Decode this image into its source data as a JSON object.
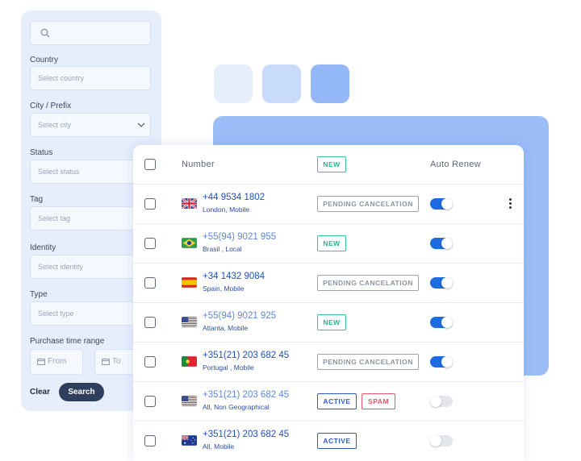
{
  "filters": {
    "search": {
      "placeholder": ""
    },
    "country": {
      "label": "Country",
      "placeholder": "Select country"
    },
    "city": {
      "label": "City / Prefix",
      "placeholder": "Select city"
    },
    "status": {
      "label": "Status",
      "placeholder": "Select status"
    },
    "tag": {
      "label": "Tag",
      "placeholder": "Select tag"
    },
    "identity": {
      "label": "Identity",
      "placeholder": "Select identity"
    },
    "type": {
      "label": "Type",
      "placeholder": "Select type"
    },
    "purchase": {
      "label": "Purchase time range",
      "from": "From",
      "to": "To"
    },
    "clear_label": "Clear",
    "search_label": "Search"
  },
  "table": {
    "headers": {
      "number": "Number",
      "status": "NEW",
      "auto_renew": "Auto Renew"
    },
    "rows": [
      {
        "flag": "uk",
        "number": "+44 9534 1802",
        "location": "London, Mobile",
        "badges": [
          "PENDING CANCELATION"
        ],
        "auto_renew": true,
        "muted": false
      },
      {
        "flag": "br",
        "number": "+55(94) 9021 955",
        "location": "Brasil  , Local",
        "badges": [
          "NEW"
        ],
        "auto_renew": true,
        "muted": true
      },
      {
        "flag": "es",
        "number": "+34 1432 9084",
        "location": "Spain, Mobile",
        "badges": [
          "PENDING CANCELATION"
        ],
        "auto_renew": true,
        "muted": false
      },
      {
        "flag": "us",
        "number": "+55(94) 9021 925",
        "location": "Atlanta, Mobile",
        "badges": [
          "NEW"
        ],
        "auto_renew": true,
        "muted": true
      },
      {
        "flag": "pt",
        "number": "+351(21) 203 682 45",
        "location": "Portugal , Mobile",
        "badges": [
          "PENDING CANCELATION"
        ],
        "auto_renew": true,
        "muted": false
      },
      {
        "flag": "us",
        "number": "+351(21) 203 682 45",
        "location": "All, Non Geographical",
        "badges": [
          "ACTIVE",
          "SPAM"
        ],
        "auto_renew": false,
        "muted": true
      },
      {
        "flag": "au",
        "number": "+351(21) 203 682 45",
        "location": "All, Mobile",
        "badges": [
          "ACTIVE"
        ],
        "auto_renew": false,
        "muted": false
      }
    ]
  },
  "colors": {
    "accent": "#1d6be0",
    "panel": "#e6eefc",
    "new": "#29b48c",
    "spam": "#e3576f",
    "active": "#2c5bc4"
  }
}
